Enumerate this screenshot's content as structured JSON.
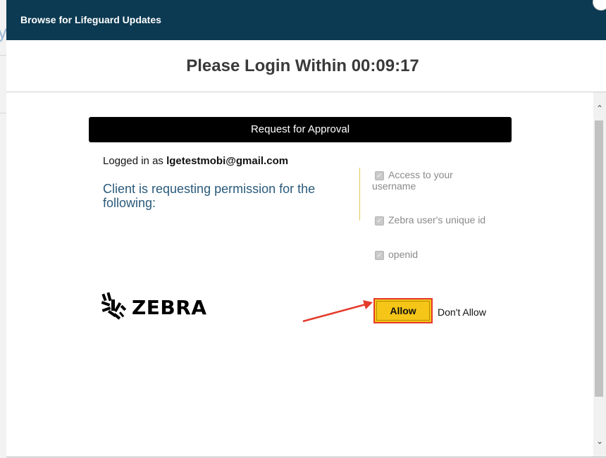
{
  "window": {
    "title": "Browse for Lifeguard Updates"
  },
  "timer": {
    "text": "Please Login Within 00:09:17"
  },
  "approval": {
    "header": "Request for Approval",
    "logged_in_prefix": "Logged in as",
    "logged_in_email": "lgetestmobi@gmail.com",
    "request_text": "Client is requesting permission for the following:"
  },
  "permissions": [
    {
      "label": "Access to your username",
      "checked": true
    },
    {
      "label": "Zebra user's unique id",
      "checked": true
    },
    {
      "label": "openid",
      "checked": true
    }
  ],
  "brand": {
    "name": "ZEBRA",
    "logo_icon": "zebra-head-icon"
  },
  "actions": {
    "allow_label": "Allow",
    "dont_allow_label": "Don't Allow"
  },
  "colors": {
    "titlebar": "#0c3a52",
    "allow_button": "#f5c518",
    "annotation": "#e43b2c",
    "request_text": "#2a5a7a"
  }
}
